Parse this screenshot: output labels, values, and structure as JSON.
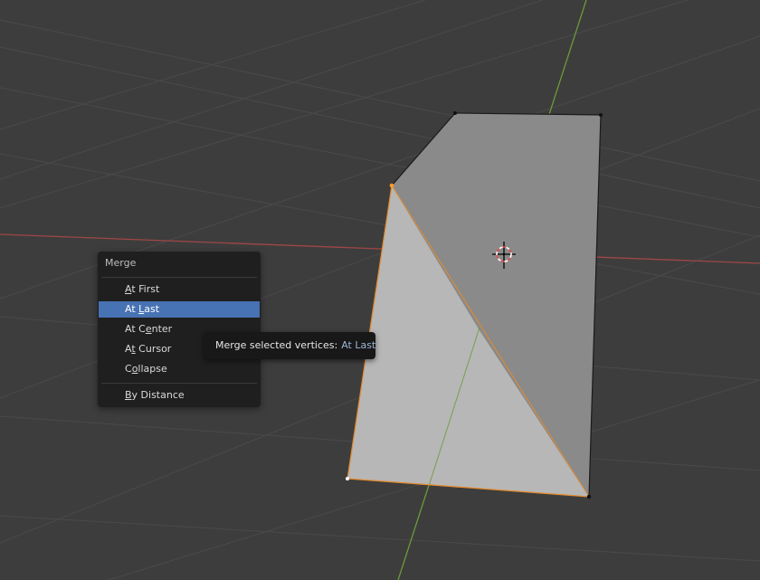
{
  "colors": {
    "background": "#3d3d3d",
    "grid_line": "#4a4a4a",
    "x_axis": "#a14646",
    "y_axis": "#6d9a3a",
    "menu_bg": "#1f1f1f",
    "menu_highlight": "#4772b3",
    "tooltip_bg": "#181818",
    "tooltip_value": "#9db4d6",
    "selected_edge": "#e38a2c",
    "selected_vertex": "#ff9a2a"
  },
  "menu": {
    "title": "Merge",
    "items": [
      {
        "pre": "",
        "key": "A",
        "post": "t First"
      },
      {
        "pre": "At ",
        "key": "L",
        "post": "ast"
      },
      {
        "pre": "At C",
        "key": "e",
        "post": "nter"
      },
      {
        "pre": "A",
        "key": "t",
        "post": " Cursor"
      },
      {
        "pre": "C",
        "key": "o",
        "post": "llapse"
      },
      {
        "pre": "",
        "key": "B",
        "post": "y Distance"
      }
    ],
    "active_index": 1
  },
  "tooltip": {
    "label": "Merge selected vertices:",
    "value": "At Last"
  },
  "icons": {
    "cursor": "3d-cursor-icon"
  }
}
